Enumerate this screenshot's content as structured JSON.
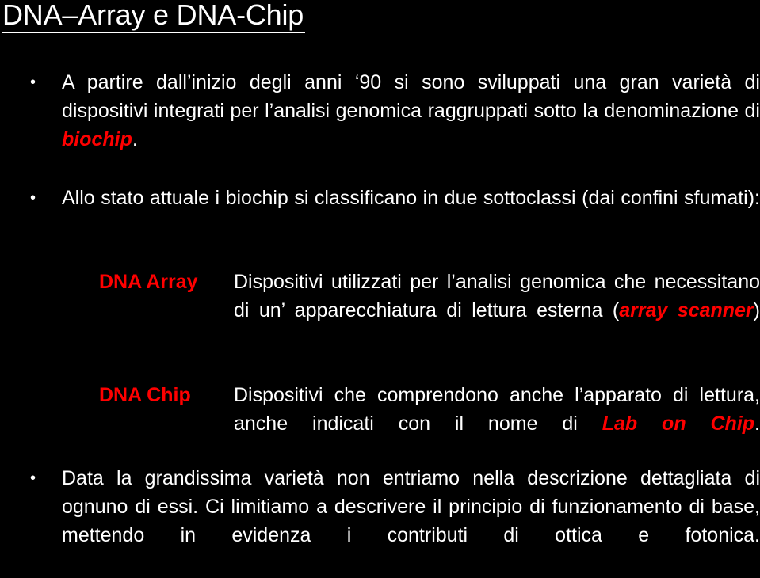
{
  "slide": {
    "title": "DNA–Array e DNA-Chip",
    "background_color": "#000000",
    "text_color": "#ffffff",
    "accent_color": "#ff0000"
  },
  "bullets": [
    {
      "marker": "•",
      "segments": [
        {
          "text": "A partire dall’inizio degli anni ‘90 si sono sviluppati una gran varietà di dispositivi integrati per l’analisi genomica raggruppati sotto la denominazione di ",
          "style": "normal"
        },
        {
          "text": "biochip",
          "style": "em-red"
        },
        {
          "text": ".",
          "style": "normal"
        }
      ],
      "plain": "A partire dall’inizio degli anni ‘90 si sono sviluppati una gran varietà di dispositivi integrati per l’analisi genomica raggruppati sotto la denominazione di biochip."
    },
    {
      "marker": "•",
      "segments": [
        {
          "text": "Allo stato attuale i biochip si classificano in due sottoclassi (dai confini sfumati):",
          "style": "normal"
        }
      ],
      "plain": "Allo stato attuale i biochip si classificano in due sottoclassi (dai confini sfumati):"
    },
    {
      "marker": "•",
      "segments": [
        {
          "text": "Data la grandissima varietà non entriamo nella descrizione dettagliata di ognuno di essi. Ci limitiamo a descrivere il principio di funzionamento di base, mettendo in evidenza i contributi di ottica e fotonica.",
          "style": "normal"
        }
      ],
      "plain": "Data la grandissima varietà non entriamo nella descrizione dettagliata di ognuno di essi. Ci limitiamo a descrivere il principio di funzionamento di base, mettendo in evidenza i contributi di ottica e fotonica."
    }
  ],
  "definitions": [
    {
      "label": "DNA Array",
      "segments": [
        {
          "text": "Dispositivi utilizzati per l’analisi genomica che necessitano di un’ apparecchiatura di lettura esterna (",
          "style": "normal"
        },
        {
          "text": "array scanner",
          "style": "em-red"
        },
        {
          "text": ")",
          "style": "normal"
        }
      ],
      "plain": "Dispositivi utilizzati per l’analisi genomica che necessitano di un’ apparecchiatura di lettura esterna (array scanner)"
    },
    {
      "label": "DNA Chip",
      "segments": [
        {
          "text": "Dispositivi che comprendono anche l’apparato di lettura, anche indicati con il nome di ",
          "style": "normal"
        },
        {
          "text": "Lab on Chip",
          "style": "em-red"
        },
        {
          "text": ".",
          "style": "normal"
        }
      ],
      "plain": "Dispositivi che comprendono anche l’apparato di lettura, anche indicati con il nome di Lab on Chip."
    }
  ]
}
